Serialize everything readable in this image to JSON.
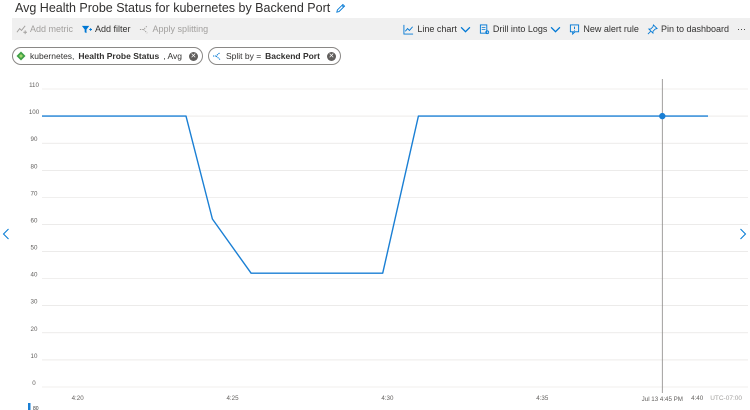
{
  "header": {
    "title": "Avg Health Probe Status for kubernetes by Backend Port"
  },
  "toolbar": {
    "add_metric": "Add metric",
    "add_filter": "Add filter",
    "apply_splitting": "Apply splitting",
    "line_chart": "Line chart",
    "drill_into_logs": "Drill into Logs",
    "new_alert_rule": "New alert rule",
    "pin_to_dashboard": "Pin to dashboard",
    "more": "···"
  },
  "pills": {
    "metric_prefix": "kubernetes,",
    "metric_bold": "Health Probe Status",
    "metric_suffix": ", Avg",
    "split_prefix": "Split by =",
    "split_bold": "Backend Port"
  },
  "colors": {
    "series": "#1a7fd4",
    "grid": "#e1dfdd",
    "cursor": "#8a8886",
    "toolbar_bg": "#f0f0f0",
    "accent_blue": "#0078d4"
  },
  "icons": {
    "title": "pencil-icon",
    "nav_left": "chevron-left-icon",
    "nav_right": "chevron-right-icon"
  },
  "chart_data": {
    "type": "line",
    "title": "",
    "xlabel": "",
    "ylabel": "",
    "ylim": [
      0,
      110
    ],
    "yticks": [
      0,
      10,
      20,
      30,
      40,
      50,
      60,
      70,
      80,
      90,
      100,
      110
    ],
    "xlim_minutes": [
      4.77,
      9.07
    ],
    "xticks": [
      {
        "value": 5.0,
        "label": "4:20"
      },
      {
        "value": 6.0,
        "label": "4:25"
      },
      {
        "value": 7.0,
        "label": "4:30"
      },
      {
        "value": 8.0,
        "label": "4:35"
      },
      {
        "value": 9.0,
        "label": "4:40"
      }
    ],
    "grid": true,
    "series": [
      {
        "name": "80",
        "x": [
          4.77,
          5.7,
          5.87,
          6.12,
          6.97,
          7.2,
          9.07
        ],
        "y": [
          100,
          100,
          62,
          42,
          42,
          100,
          100
        ]
      }
    ],
    "cursor": {
      "x": 8.775,
      "y": 100,
      "label": "Jul 13 4:45 PM"
    },
    "timezone": "UTC-07:00",
    "legend": {
      "position": "bottom-left",
      "entries": [
        "80"
      ]
    }
  }
}
